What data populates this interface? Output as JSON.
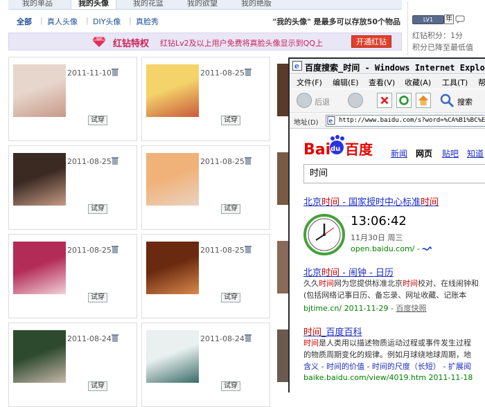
{
  "top_tabs": [
    "我的单品",
    "我的头像",
    "我的花篮",
    "我的欲望",
    "我的绝版"
  ],
  "subnav": {
    "items": [
      "全部",
      "真人头像",
      "DIY头像",
      "真脸秀"
    ],
    "note": "\"我的头像\" 是最多可以存放50个物品"
  },
  "banner": {
    "title": "红钻特权",
    "text": "红钻Lv2及以上用户免费将真脸头像显示到QQ上",
    "button": "开通红钻"
  },
  "sidebar": {
    "lv_badge": "LV1",
    "year_badge": "年",
    "score_label": "红钻积分：1分",
    "score_note": "积分已降至最低值"
  },
  "cards": [
    {
      "date": "2011-11-10",
      "try": "试穿",
      "palette": [
        "#e7d6cc",
        "#c79988"
      ]
    },
    {
      "date": "2011-08-25",
      "try": "试穿",
      "palette": [
        "#f4d36b",
        "#c95a3a"
      ]
    },
    {
      "date": "2011-08-25",
      "try": "试穿",
      "palette": [
        "#3a2a22",
        "#c79a86"
      ]
    },
    {
      "date": "2011-08-25",
      "try": "试穿",
      "palette": [
        "#f1b279",
        "#e9d2c1"
      ]
    },
    {
      "date": "2011-08-25",
      "try": "试穿",
      "palette": [
        "#b32b57",
        "#f0d0d8"
      ]
    },
    {
      "date": "2011-08-25",
      "try": "试穿",
      "palette": [
        "#6a2a10",
        "#d9884a"
      ]
    },
    {
      "date": "2011-08-24",
      "try": "试穿",
      "palette": [
        "#2d4a2f",
        "#c8b7a8"
      ]
    },
    {
      "date": "2011-08-24",
      "try": "试穿",
      "palette": [
        "#e9f0ef",
        "#3a6b68"
      ]
    }
  ],
  "browser": {
    "title": "百度搜索_时间 - Windows Internet Explo",
    "menus": [
      "文件(F)",
      "编辑(E)",
      "查看(V)",
      "收藏(A)",
      "工具(T)",
      "帮"
    ],
    "back_label": "后退",
    "search_label": "搜索",
    "address_label": "地址(D)",
    "address_url": "http://www.baidu.com/s?word=%CA%B1%BC%E4",
    "nav_links": [
      "新闻",
      "网页",
      "贴吧",
      "知道"
    ],
    "query": "时间",
    "results": [
      {
        "title_pre": "北京",
        "title_hl": "时间",
        "title_post": " - 国家授时中心标准",
        "title_hl2": "时间"
      },
      {
        "title_pre": "北京",
        "title_hl": "时间",
        "title_post": " - 闹钟 - 日历",
        "line1_pre": "久久",
        "line1_hl": "时间",
        "line1_mid": "网为您提供标准北京",
        "line1_hl2": "时间",
        "line1_post": "校对、在线闹钟和",
        "line2": "(包括网络记事日历、备忘录、网址收藏、记账本",
        "url": "bjtime.cn/ 2011-11-29 - ",
        "cache": "百度快照"
      },
      {
        "title_pre": "",
        "title_hl": "时间",
        "title_post": "_百度百科",
        "line1_hl": "时间",
        "line1_post": "是人类用以描述物质运动过程或事件发生过程",
        "line2": "的物质周期变化的规律。例如月球绕地球周期，地",
        "links": "含义 - 时间的价值 - 时间的尺度（长短） - 扩展阅",
        "url": "baike.baidu.com/view/4019.htm 2011-11-18"
      }
    ],
    "clock": {
      "time": "13:06:42",
      "date": "11月30日  周三",
      "url": "open.baidu.com/ - "
    }
  }
}
